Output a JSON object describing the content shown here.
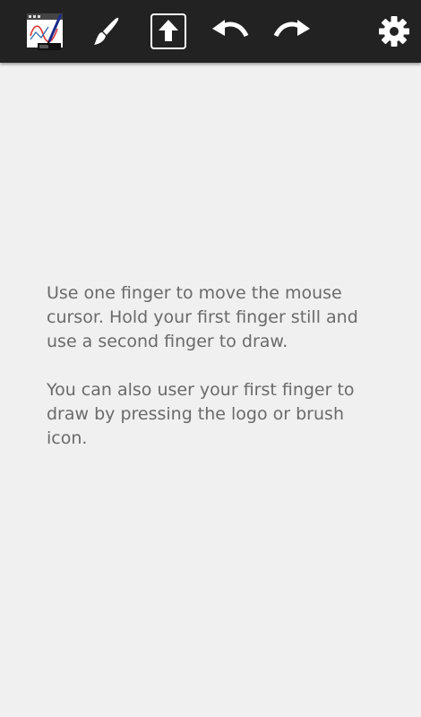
{
  "toolbar": {
    "background": "#222222",
    "icons": [
      {
        "name": "app-logo-icon",
        "interactable": true
      },
      {
        "name": "brush-icon",
        "interactable": true
      },
      {
        "name": "upload-icon",
        "interactable": true
      },
      {
        "name": "undo-icon",
        "interactable": true
      },
      {
        "name": "redo-icon",
        "interactable": true
      },
      {
        "name": "gear-icon",
        "interactable": true
      }
    ]
  },
  "main": {
    "instructions": [
      "Use one finger to move the mouse cursor. Hold your first finger still and use a second finger to draw.",
      "You can also user your first finger to draw by pressing the logo or brush icon."
    ],
    "text_color": "#6a6a6a",
    "background": "#f0f0f0"
  }
}
